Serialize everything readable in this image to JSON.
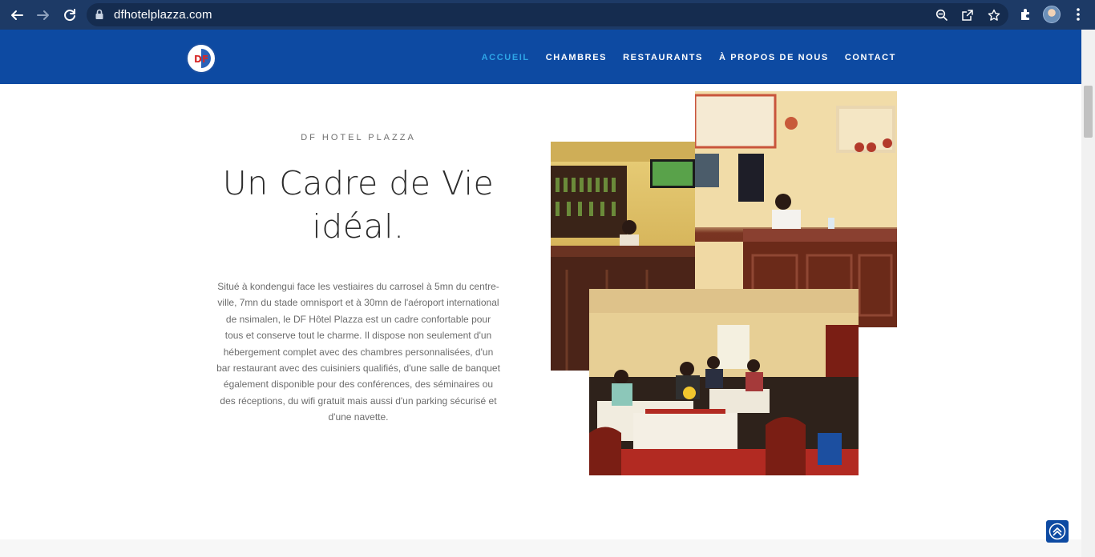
{
  "browser": {
    "url": "dfhotelplazza.com",
    "toolbar_icons": [
      "back-arrow-icon",
      "forward-arrow-icon",
      "reload-icon",
      "lock-icon",
      "zoom-icon",
      "share-icon",
      "star-icon",
      "extensions-icon",
      "profile-avatar",
      "menu-dots-icon"
    ],
    "colors": {
      "chrome_bg": "#1d3a66",
      "urlbar_bg": "#152c4f"
    }
  },
  "site": {
    "logo_text": "DF",
    "nav": [
      {
        "label": "ACCUEIL",
        "active": true
      },
      {
        "label": "CHAMBRES",
        "active": false
      },
      {
        "label": "RESTAURANTS",
        "active": false
      },
      {
        "label": "À PROPOS DE NOUS",
        "active": false
      },
      {
        "label": "CONTACT",
        "active": false
      }
    ],
    "colors": {
      "header_bg": "#0d4aa2",
      "nav_active": "#2ea6e8"
    }
  },
  "content": {
    "eyebrow": "DF HOTEL PLAZZA",
    "headline": "Un Cadre de Vie idéal.",
    "body": "Situé à kondengui face les vestiaires du carrosel à 5mn du centre-ville, 7mn du stade omnisport et à 30mn de l'aéroport international de nsimalen, le DF Hôtel Plazza est un cadre confortable pour tous et conserve tout le charme. Il dispose non seulement d'un hébergement complet avec des chambres personnalisées, d'un bar restaurant avec des cuisiniers qualifiés, d'une salle de banquet également disponible pour des conférences, des séminaires ou des réceptions, du wifi gratuit mais aussi d'un parking sécurisé et d'une navette."
  }
}
